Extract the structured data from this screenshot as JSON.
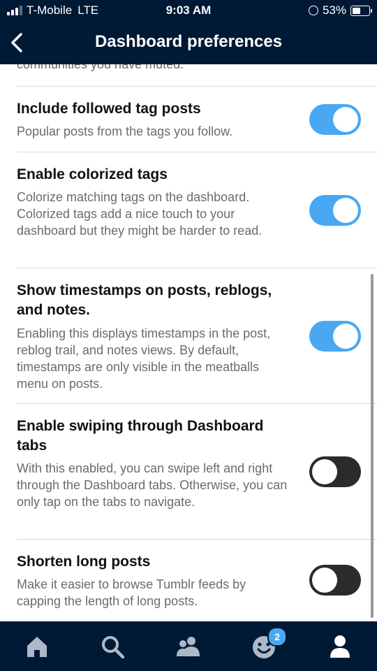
{
  "status_bar": {
    "carrier": "T-Mobile",
    "network": "LTE",
    "time": "9:03 AM",
    "battery": "53%",
    "battery_level": 0.53
  },
  "nav": {
    "title": "Dashboard preferences",
    "back_icon": "chevron-left-icon"
  },
  "partial_text": "communities you have muted.",
  "settings": [
    {
      "title": "Include followed tag posts",
      "description": "Popular posts from the tags you follow.",
      "enabled": true
    },
    {
      "title": "Enable colorized tags",
      "description": "Colorize matching tags on the dashboard. Colorized tags add a nice touch to your dashboard but they might be harder to read.",
      "enabled": true
    },
    {
      "title": "Show timestamps on posts, reblogs, and notes.",
      "description": "Enabling this displays timestamps in the post, reblog trail, and notes views. By default, timestamps are only visible in the meatballs menu on posts.",
      "enabled": true
    },
    {
      "title": "Enable swiping through Dashboard tabs",
      "description": "With this enabled, you can swipe left and right through the Dashboard tabs. Otherwise, you can only tap on the tabs to navigate.",
      "enabled": false
    },
    {
      "title": "Shorten long posts",
      "description": "Make it easier to browse Tumblr feeds by capping the length of long posts.",
      "enabled": false
    }
  ],
  "tab_bar": {
    "tabs": [
      "home-icon",
      "search-icon",
      "people-icon",
      "activity-face-icon",
      "account-icon"
    ],
    "activity_badge": "2"
  },
  "colors": {
    "navy": "#001935",
    "toggle_on": "#4aa8f2",
    "toggle_off": "#2b2b2b"
  }
}
